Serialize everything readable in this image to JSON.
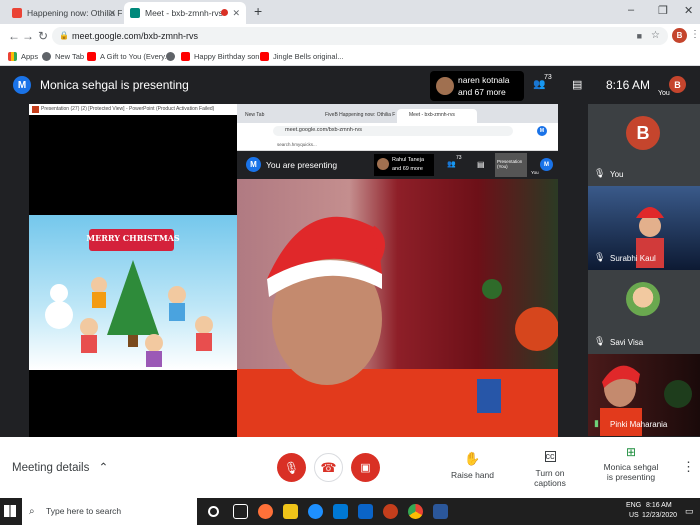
{
  "browser": {
    "tabs": [
      {
        "label": "Happening now: Othilia Fernand",
        "active": false
      },
      {
        "label": "Meet - bxb-zmnh-rvs",
        "active": true
      }
    ],
    "new_tab_label": "+",
    "url": "meet.google.com/bxb-zmnh-rvs",
    "bookmarks": [
      "Apps",
      "New Tab",
      "A Gift to You (Every...",
      "Happy Birthday son...",
      "Jingle Bells original..."
    ]
  },
  "meet": {
    "presenter_banner": "Monica sehgal is presenting",
    "presenter_initial": "M",
    "participants_summary_name": "naren kotnala",
    "participants_summary_more": "and 67 more",
    "participant_count": "73",
    "time": "8:16 AM",
    "self_label": "You",
    "self_initial": "B",
    "tiles": [
      {
        "name": "You",
        "initial": "B"
      },
      {
        "name": "Surabhi Kaul"
      },
      {
        "name": "Savi Visa"
      },
      {
        "name": "Pinki Maharania"
      }
    ],
    "shared_screen": {
      "powerpoint_title": "Presentation (27) (2) [Protected View] - PowerPoint (Product Activation Failed)",
      "slide_title": "MERRY CHRISTMAS",
      "inner_tabs": [
        "New Tab",
        "FiveB Happening now: Othilia F",
        "Meet - bxb-zmnh-rvs"
      ],
      "inner_url": "meet.google.com/bxb-zmnh-rvs",
      "inner_bookmark": "search.hmyquicks...",
      "inner_banner": "You are presenting",
      "inner_participant": "Rahul Taneja",
      "inner_more": "and 69 more",
      "inner_count": "73",
      "inner_presentation_label": "Presentation (You)",
      "inner_you": "You",
      "inner_initial": "M"
    },
    "controls": {
      "meeting_details": "Meeting details",
      "raise_hand": "Raise hand",
      "captions": "Turn on captions",
      "presenting_line1": "Monica sehgal",
      "presenting_line2": "is presenting"
    }
  },
  "taskbar": {
    "search_placeholder": "Type here to search",
    "lang_top": "ENG",
    "lang_bottom": "US",
    "time": "8:16 AM",
    "date": "12/23/2020"
  },
  "colors": {
    "meet_bg": "#202124",
    "end_call": "#d93025",
    "presenter_blue": "#1a73e8",
    "self_avatar": "#c5452d"
  }
}
